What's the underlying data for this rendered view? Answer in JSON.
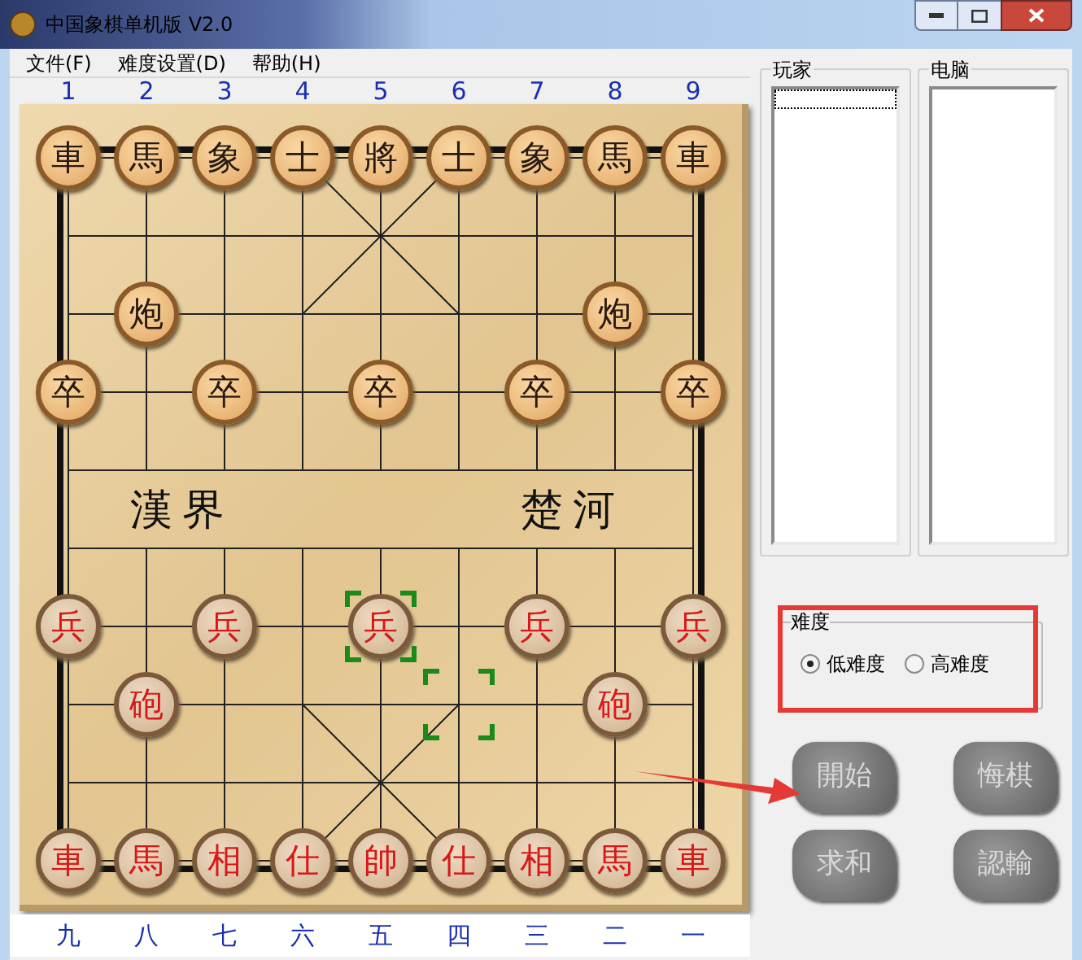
{
  "window": {
    "title": "中国象棋单机版 V2.0"
  },
  "menu": [
    "文件(F)",
    "难度设置(D)",
    "帮助(H)"
  ],
  "top_file_labels": [
    "1",
    "2",
    "3",
    "4",
    "5",
    "6",
    "7",
    "8",
    "9"
  ],
  "bottom_file_labels": [
    "九",
    "八",
    "七",
    "六",
    "五",
    "四",
    "三",
    "二",
    "一"
  ],
  "river": {
    "left_text": "漢界",
    "right_text": "楚河"
  },
  "board": {
    "rows": [
      [
        {
          "kind": "black",
          "piece": "車"
        },
        {
          "kind": "black",
          "piece": "馬"
        },
        {
          "kind": "black",
          "piece": "象"
        },
        {
          "kind": "black",
          "piece": "士"
        },
        {
          "kind": "black",
          "piece": "將"
        },
        {
          "kind": "black",
          "piece": "士"
        },
        {
          "kind": "black",
          "piece": "象"
        },
        {
          "kind": "black",
          "piece": "馬"
        },
        {
          "kind": "black",
          "piece": "車"
        }
      ],
      [
        {
          "kind": "empty"
        },
        {
          "kind": "empty"
        },
        {
          "kind": "empty"
        },
        {
          "kind": "empty"
        },
        {
          "kind": "empty"
        },
        {
          "kind": "empty"
        },
        {
          "kind": "empty"
        },
        {
          "kind": "empty"
        },
        {
          "kind": "empty"
        }
      ],
      [
        {
          "kind": "empty"
        },
        {
          "kind": "black",
          "piece": "炮"
        },
        {
          "kind": "empty"
        },
        {
          "kind": "empty"
        },
        {
          "kind": "empty"
        },
        {
          "kind": "empty"
        },
        {
          "kind": "empty"
        },
        {
          "kind": "black",
          "piece": "炮"
        },
        {
          "kind": "empty"
        }
      ],
      [
        {
          "kind": "black",
          "piece": "卒"
        },
        {
          "kind": "empty"
        },
        {
          "kind": "black",
          "piece": "卒"
        },
        {
          "kind": "empty"
        },
        {
          "kind": "black",
          "piece": "卒"
        },
        {
          "kind": "empty"
        },
        {
          "kind": "black",
          "piece": "卒"
        },
        {
          "kind": "empty"
        },
        {
          "kind": "black",
          "piece": "卒"
        }
      ],
      [
        {
          "kind": "empty"
        },
        {
          "kind": "empty"
        },
        {
          "kind": "empty"
        },
        {
          "kind": "empty"
        },
        {
          "kind": "empty"
        },
        {
          "kind": "empty"
        },
        {
          "kind": "empty"
        },
        {
          "kind": "empty"
        },
        {
          "kind": "empty"
        }
      ],
      [
        {
          "kind": "empty"
        },
        {
          "kind": "empty"
        },
        {
          "kind": "empty"
        },
        {
          "kind": "empty"
        },
        {
          "kind": "empty"
        },
        {
          "kind": "empty"
        },
        {
          "kind": "empty"
        },
        {
          "kind": "empty"
        },
        {
          "kind": "empty"
        }
      ],
      [
        {
          "kind": "red",
          "piece": "兵"
        },
        {
          "kind": "empty"
        },
        {
          "kind": "red",
          "piece": "兵"
        },
        {
          "kind": "empty"
        },
        {
          "kind": "red-framed",
          "piece": "兵"
        },
        {
          "kind": "empty"
        },
        {
          "kind": "red",
          "piece": "兵"
        },
        {
          "kind": "empty"
        },
        {
          "kind": "red",
          "piece": "兵"
        }
      ],
      [
        {
          "kind": "empty"
        },
        {
          "kind": "red",
          "piece": "砲"
        },
        {
          "kind": "empty"
        },
        {
          "kind": "empty"
        },
        {
          "kind": "empty"
        },
        {
          "kind": "framed"
        },
        {
          "kind": "empty"
        },
        {
          "kind": "red",
          "piece": "砲"
        },
        {
          "kind": "empty"
        }
      ],
      [
        {
          "kind": "empty"
        },
        {
          "kind": "empty"
        },
        {
          "kind": "empty"
        },
        {
          "kind": "empty"
        },
        {
          "kind": "empty"
        },
        {
          "kind": "empty"
        },
        {
          "kind": "empty"
        },
        {
          "kind": "empty"
        },
        {
          "kind": "empty"
        }
      ],
      [
        {
          "kind": "red",
          "piece": "車"
        },
        {
          "kind": "red",
          "piece": "馬"
        },
        {
          "kind": "red",
          "piece": "相"
        },
        {
          "kind": "red",
          "piece": "仕"
        },
        {
          "kind": "red",
          "piece": "帥"
        },
        {
          "kind": "red",
          "piece": "仕"
        },
        {
          "kind": "red",
          "piece": "相"
        },
        {
          "kind": "red",
          "piece": "馬"
        },
        {
          "kind": "red",
          "piece": "車"
        }
      ]
    ]
  },
  "player_panel": {
    "title": "玩家"
  },
  "computer_panel": {
    "title": "电脑"
  },
  "difficulty": {
    "title": "难度",
    "options": [
      {
        "label": "低难度",
        "selected": true
      },
      {
        "label": "高难度",
        "selected": false
      }
    ]
  },
  "buttons": [
    "開始",
    "悔棋",
    "求和",
    "認輸"
  ]
}
